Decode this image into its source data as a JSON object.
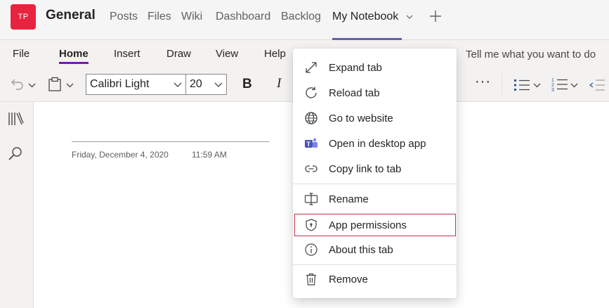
{
  "team": {
    "initials": "TP",
    "avatar_color": "#e8233f",
    "channel": "General"
  },
  "tabs": [
    {
      "label": "Posts"
    },
    {
      "label": "Files"
    },
    {
      "label": "Wiki"
    },
    {
      "label": "Dashboard"
    },
    {
      "label": "Backlog"
    },
    {
      "label": "My Notebook",
      "active": true
    }
  ],
  "ribbon": {
    "tabs": [
      {
        "label": "File"
      },
      {
        "label": "Home",
        "active": true
      },
      {
        "label": "Insert"
      },
      {
        "label": "Draw"
      },
      {
        "label": "View"
      },
      {
        "label": "Help"
      }
    ],
    "tell_me": "Tell me what you want to do",
    "font_name": "Calibri Light",
    "font_size": "20",
    "bold_label": "B",
    "italic_label": "I",
    "more_label": "···"
  },
  "page": {
    "date": "Friday, December 4, 2020",
    "time": "11:59 AM"
  },
  "menu": {
    "items": [
      {
        "label": "Expand tab",
        "icon": "expand-icon"
      },
      {
        "label": "Reload tab",
        "icon": "reload-icon"
      },
      {
        "label": "Go to website",
        "icon": "globe-icon"
      },
      {
        "label": "Open in desktop app",
        "icon": "teams-icon"
      },
      {
        "label": "Copy link to tab",
        "icon": "link-icon"
      },
      {
        "label": "Rename",
        "icon": "rename-icon"
      },
      {
        "label": "App permissions",
        "icon": "shield-icon",
        "focused": true
      },
      {
        "label": "About this tab",
        "icon": "info-icon"
      },
      {
        "label": "Remove",
        "icon": "trash-icon"
      }
    ]
  },
  "colors": {
    "accent": "#6264a7",
    "onenote": "#7719aa",
    "focus_outline": "#c4314b"
  }
}
